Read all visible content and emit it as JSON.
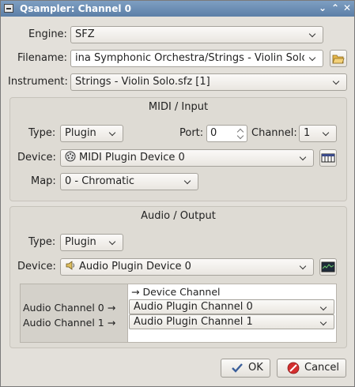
{
  "window": {
    "title": "Qsampler: Channel 0"
  },
  "engine": {
    "label": "Engine:",
    "value": "SFZ"
  },
  "filename": {
    "label": "Filename:",
    "value": "ina Symphonic Orchestra/Strings - Violin Solo.sfz"
  },
  "instrument": {
    "label": "Instrument:",
    "value": "Strings - Violin Solo.sfz [1]"
  },
  "midi": {
    "title": "MIDI / Input",
    "type_label": "Type:",
    "type_value": "Plugin",
    "port_label": "Port:",
    "port_value": "0",
    "channel_label": "Channel:",
    "channel_value": "1",
    "device_label": "Device:",
    "device_value": "MIDI Plugin Device 0",
    "map_label": "Map:",
    "map_value": "0 - Chromatic"
  },
  "audio": {
    "title": "Audio / Output",
    "type_label": "Type:",
    "type_value": "Plugin",
    "device_label": "Device:",
    "device_value": "Audio Plugin Device 0",
    "routing_header": "→ Device Channel",
    "rows": [
      {
        "label": "Audio Channel 0 →",
        "value": "Audio Plugin Channel 0"
      },
      {
        "label": "Audio Channel 1 →",
        "value": "Audio Plugin Channel 1"
      }
    ]
  },
  "buttons": {
    "ok": "OK",
    "cancel": "Cancel"
  }
}
